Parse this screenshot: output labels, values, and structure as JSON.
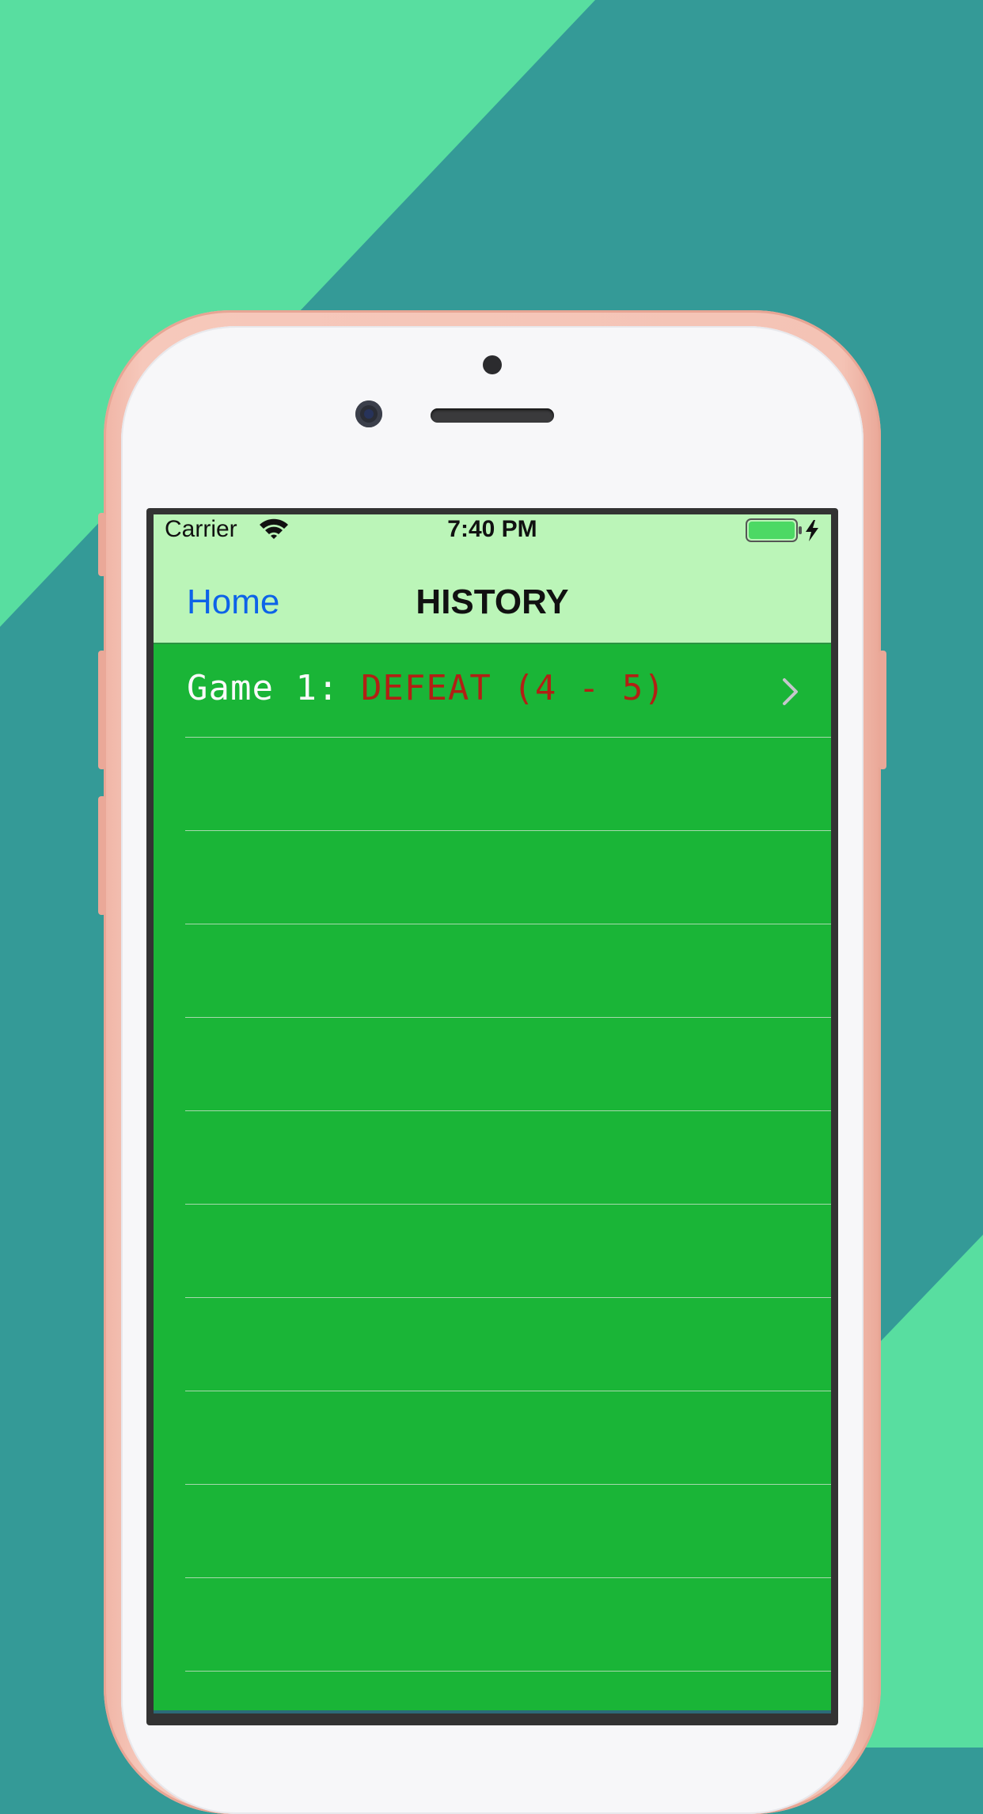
{
  "colors": {
    "background_dark": "#349a97",
    "background_light": "#58dea0",
    "nav_bar": "#bbf5b8",
    "table_background": "#1ab537",
    "back_link": "#0d63e8",
    "defeat_text": "#b22014",
    "battery_fill": "#4cd964"
  },
  "status_bar": {
    "carrier": "Carrier",
    "time": "7:40 PM",
    "wifi_icon": "wifi-icon",
    "battery_icon": "battery-charging-icon"
  },
  "nav": {
    "back_label": "Home",
    "title": "HISTORY"
  },
  "games": [
    {
      "prefix": "Game 1:",
      "result": "DEFEAT (4 - 5)",
      "chevron_icon": "chevron-right-icon"
    }
  ],
  "empty_rows": 10
}
